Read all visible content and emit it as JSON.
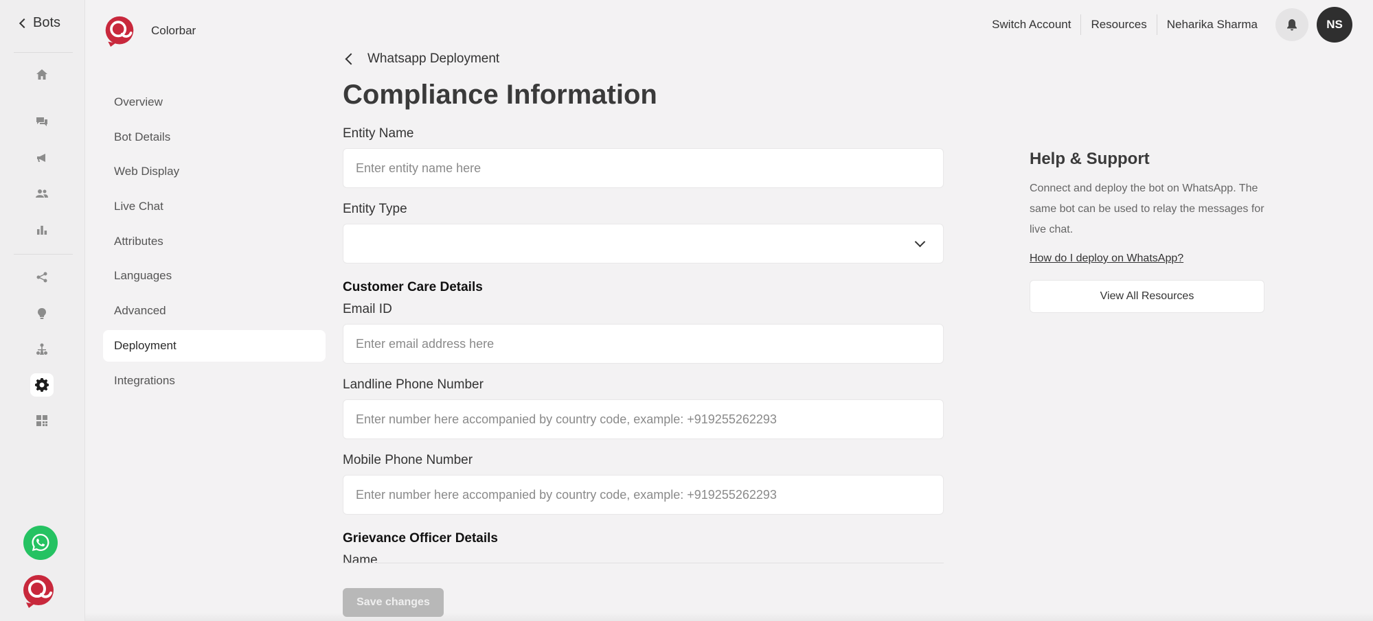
{
  "rail": {
    "back_label": "Bots",
    "icons": [
      "home-icon",
      "chat-icon",
      "megaphone-icon",
      "users-icon",
      "bar-chart-icon",
      "flow-icon",
      "bulb-icon",
      "org-icon",
      "gear-icon",
      "qr-icon"
    ],
    "active_icon": "gear-icon"
  },
  "sidebar": {
    "bot_name": "Colorbar",
    "items": [
      {
        "label": "Overview"
      },
      {
        "label": "Bot Details"
      },
      {
        "label": "Web Display"
      },
      {
        "label": "Live Chat"
      },
      {
        "label": "Attributes"
      },
      {
        "label": "Languages"
      },
      {
        "label": "Advanced"
      },
      {
        "label": "Deployment"
      },
      {
        "label": "Integrations"
      }
    ],
    "active": "Deployment"
  },
  "header": {
    "switch_account": "Switch Account",
    "resources": "Resources",
    "user_name": "Neharika Sharma",
    "avatar_initials": "NS"
  },
  "main": {
    "breadcrumb": "Whatsapp Deployment",
    "title": "Compliance Information",
    "entity_name_label": "Entity Name",
    "entity_name_placeholder": "Enter entity name here",
    "entity_type_label": "Entity Type",
    "entity_type_value": "",
    "customer_care_heading": "Customer Care Details",
    "email_label": "Email ID",
    "email_placeholder": "Enter email address here",
    "landline_label": "Landline Phone Number",
    "landline_placeholder": "Enter number here accompanied by country code, example: +919255262293",
    "mobile_label": "Mobile Phone Number",
    "mobile_placeholder": "Enter number here accompanied by country code, example: +919255262293",
    "grievance_heading": "Grievance Officer Details",
    "name_label": "Name",
    "save_label": "Save changes"
  },
  "help": {
    "title": "Help & Support",
    "body": "Connect and deploy the bot on WhatsApp. The same bot can be used to relay the messages for live chat.",
    "link": "How do I deploy on WhatsApp?",
    "view_all": "View All Resources"
  },
  "colors": {
    "brand": "#c8283c",
    "whatsapp": "#25c262",
    "background": "#f3f2f3"
  }
}
